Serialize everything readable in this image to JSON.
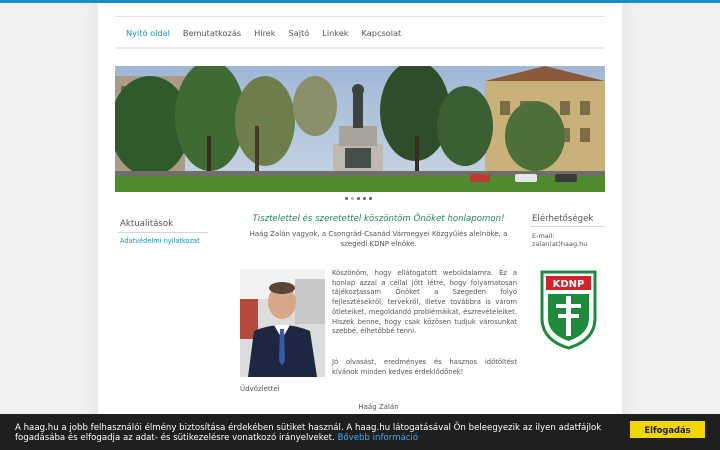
{
  "nav": {
    "items": [
      "Nyitó oldal",
      "Bemutatkozás",
      "Hírek",
      "Sajtó",
      "Linkek",
      "Kapcsolat"
    ],
    "active_index": 0
  },
  "slider": {
    "dot_count": 5,
    "active_dot": 0
  },
  "left_sidebar": {
    "title": "Aktualitások",
    "link": "Adatvédelmi nyilatkozat"
  },
  "main": {
    "welcome": "Tisztelettel és szeretettel köszöntöm Önöket honlapomon!",
    "intro": "Haág Zalán vagyok, a Csongrád-Csanád Vármegyei Közgyűlés alelnöke, a szegedi KDNP elnöke.",
    "para1": "Köszönöm, hogy ellátogatott weboldalamra. Ez a honlap azzal a céllal jött létre, hogy folyamatosan tájékoztassam Önöket a Szegeden folyó fejlesztésekről, tervekről, illetve továbbra is várom ötleteiket, megoldandó problémáikat, észrevételeiket. Hiszek benne, hogy csak közösen tudjuk városunkat szebbé, élhetőbbé tenni.",
    "para2": "Jó olvasást, eredményes és hasznos időtöltést kívánok minden kedves érdeklődőnek!",
    "greeting": "Üdvözlettel",
    "signature": "Haág Zalán"
  },
  "right_sidebar": {
    "title": "Elérhetőségek",
    "email_label": "E-mail:",
    "email_value": "zalan(at)haag.hu",
    "logo_text": "KDNP"
  },
  "cookie": {
    "text": "A haag.hu a jobb felhasználói élmény biztosítása érdekében sütiket használ. A haag.hu látogatásával Ön beleegyezik az ilyen adatfájlok fogadásába és elfogadja az adat- és sütikezelésre vonatkozó irányelveket.",
    "more_link": "Bővebb információ",
    "accept_label": "Elfogadás"
  },
  "colors": {
    "accent": "#1a8fc8",
    "welcome_green": "#1f8a52",
    "cookie_bg": "#1f1f1f",
    "cookie_button": "#f1d600",
    "kdnp_green": "#1e8a3c",
    "kdnp_red": "#d2232a"
  }
}
